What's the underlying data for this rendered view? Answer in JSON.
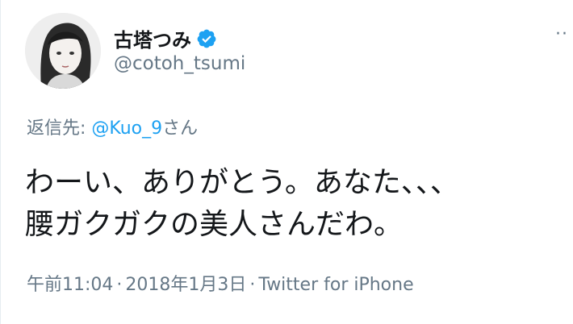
{
  "user": {
    "display_name": "古塔つみ",
    "handle": "@cotoh_tsumi",
    "verified": true
  },
  "icons": {
    "avatar": "avatar-portrait",
    "verified": "verified-badge-icon",
    "more": "more-options-icon"
  },
  "more_label": "··",
  "reply": {
    "prefix": "返信先: ",
    "mention": "@Kuo_9",
    "suffix": "さん"
  },
  "tweet": {
    "line1": "わーい、ありがとう。あなた、、、",
    "line2": "腰ガクガクの美人さんだわ。"
  },
  "meta": {
    "time": "午前11:04",
    "separator": "·",
    "date": "2018年1月3日",
    "source": "Twitter for iPhone"
  },
  "colors": {
    "text": "#14171a",
    "secondary": "#657786",
    "link": "#1da1f2"
  }
}
